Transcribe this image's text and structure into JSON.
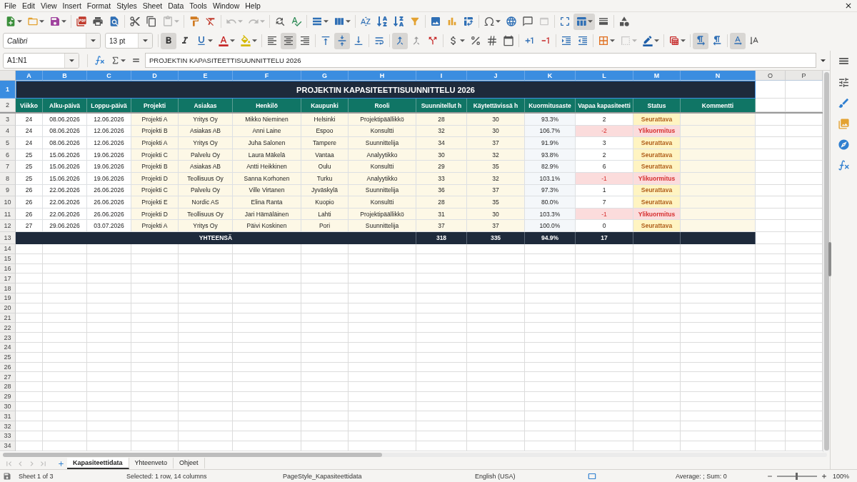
{
  "menu_bar": {
    "items": [
      "File",
      "Edit",
      "View",
      "Insert",
      "Format",
      "Styles",
      "Sheet",
      "Data",
      "Tools",
      "Window",
      "Help"
    ]
  },
  "standard_toolbar": [
    [
      {
        "kind": "new",
        "dropdown": true,
        "pressed": false,
        "disabled": false
      },
      {
        "kind": "open",
        "dropdown": true,
        "pressed": false,
        "disabled": false
      },
      {
        "kind": "save",
        "dropdown": true,
        "pressed": false,
        "disabled": false
      }
    ],
    [
      {
        "kind": "pdf",
        "dropdown": false,
        "pressed": false,
        "disabled": false
      },
      {
        "kind": "print",
        "dropdown": false,
        "pressed": false,
        "disabled": false
      },
      {
        "kind": "preview",
        "dropdown": false,
        "pressed": false,
        "disabled": false
      }
    ],
    [
      {
        "kind": "cut",
        "dropdown": false,
        "pressed": false,
        "disabled": false
      },
      {
        "kind": "copy",
        "dropdown": false,
        "pressed": false,
        "disabled": false
      },
      {
        "kind": "paste",
        "dropdown": true,
        "pressed": false,
        "disabled": true
      }
    ],
    [
      {
        "kind": "clone",
        "dropdown": false,
        "pressed": false,
        "disabled": false
      },
      {
        "kind": "clear",
        "dropdown": false,
        "pressed": false,
        "disabled": false
      }
    ],
    [
      {
        "kind": "undo",
        "dropdown": true,
        "pressed": false,
        "disabled": true
      },
      {
        "kind": "redo",
        "dropdown": true,
        "pressed": false,
        "disabled": true
      }
    ],
    [
      {
        "kind": "find",
        "dropdown": false,
        "pressed": false,
        "disabled": false
      },
      {
        "kind": "spelling",
        "dropdown": false,
        "pressed": false,
        "disabled": false
      }
    ],
    [
      {
        "kind": "rows",
        "dropdown": true,
        "pressed": false,
        "disabled": false
      },
      {
        "kind": "columns",
        "dropdown": true,
        "pressed": false,
        "disabled": false
      }
    ],
    [
      {
        "kind": "sort",
        "dropdown": false,
        "pressed": false,
        "disabled": false
      },
      {
        "kind": "sortasc",
        "dropdown": false,
        "pressed": false,
        "disabled": false
      },
      {
        "kind": "sortdesc",
        "dropdown": false,
        "pressed": false,
        "disabled": false
      },
      {
        "kind": "filter",
        "dropdown": false,
        "pressed": false,
        "disabled": false
      }
    ],
    [
      {
        "kind": "image",
        "dropdown": false,
        "pressed": false,
        "disabled": false
      },
      {
        "kind": "chart",
        "dropdown": false,
        "pressed": false,
        "disabled": false
      },
      {
        "kind": "pivot",
        "dropdown": false,
        "pressed": false,
        "disabled": false
      }
    ],
    [
      {
        "kind": "special",
        "dropdown": true,
        "pressed": false,
        "disabled": false
      },
      {
        "kind": "link",
        "dropdown": false,
        "pressed": false,
        "disabled": false
      },
      {
        "kind": "comment",
        "dropdown": false,
        "pressed": false,
        "disabled": false
      },
      {
        "kind": "header",
        "dropdown": false,
        "pressed": false,
        "disabled": true
      }
    ],
    [
      {
        "kind": "printarea",
        "dropdown": false,
        "pressed": false,
        "disabled": false
      },
      {
        "kind": "freeze",
        "dropdown": true,
        "pressed": true,
        "disabled": false
      },
      {
        "kind": "split",
        "dropdown": false,
        "pressed": false,
        "disabled": false
      }
    ],
    [
      {
        "kind": "draw",
        "dropdown": false,
        "pressed": false,
        "disabled": false
      }
    ]
  ],
  "formatting_toolbar": {
    "font_name": "Calibri",
    "font_size": "13 pt",
    "groups": [
      [
        {
          "kind": "bold",
          "dropdown": false,
          "pressed": true,
          "disabled": false
        },
        {
          "kind": "italic",
          "dropdown": false,
          "pressed": false,
          "disabled": false
        },
        {
          "kind": "underline",
          "dropdown": true,
          "pressed": false,
          "disabled": false
        },
        {
          "kind": "fontcolor",
          "dropdown": true,
          "pressed": false,
          "disabled": false
        },
        {
          "kind": "highlight",
          "dropdown": true,
          "pressed": false,
          "disabled": false
        }
      ],
      [
        {
          "kind": "alignleft",
          "dropdown": false,
          "pressed": false,
          "disabled": false
        },
        {
          "kind": "aligncenter",
          "dropdown": false,
          "pressed": true,
          "disabled": false
        },
        {
          "kind": "alignright",
          "dropdown": false,
          "pressed": false,
          "disabled": false
        }
      ],
      [
        {
          "kind": "aligntop",
          "dropdown": false,
          "pressed": false,
          "disabled": false
        },
        {
          "kind": "alignmiddle",
          "dropdown": false,
          "pressed": true,
          "disabled": false
        },
        {
          "kind": "alignbottom",
          "dropdown": false,
          "pressed": false,
          "disabled": false
        }
      ],
      [
        {
          "kind": "wrap",
          "dropdown": false,
          "pressed": false,
          "disabled": false
        }
      ],
      [
        {
          "kind": "mergecenter",
          "dropdown": false,
          "pressed": true,
          "disabled": false
        },
        {
          "kind": "merge",
          "dropdown": false,
          "pressed": false,
          "disabled": false
        },
        {
          "kind": "unmerge",
          "dropdown": false,
          "pressed": false,
          "disabled": false
        }
      ],
      [
        {
          "kind": "currency",
          "dropdown": true,
          "pressed": false,
          "disabled": false
        },
        {
          "kind": "percent",
          "dropdown": false,
          "pressed": false,
          "disabled": false
        },
        {
          "kind": "number",
          "dropdown": false,
          "pressed": false,
          "disabled": false
        },
        {
          "kind": "date",
          "dropdown": false,
          "pressed": false,
          "disabled": false
        }
      ],
      [
        {
          "kind": "adddecimal",
          "dropdown": false,
          "pressed": false,
          "disabled": false
        },
        {
          "kind": "deldecimal",
          "dropdown": false,
          "pressed": false,
          "disabled": false
        }
      ],
      [
        {
          "kind": "indent",
          "dropdown": false,
          "pressed": false,
          "disabled": false
        },
        {
          "kind": "outdent",
          "dropdown": false,
          "pressed": false,
          "disabled": false
        }
      ],
      [
        {
          "kind": "borders",
          "dropdown": true,
          "pressed": false,
          "disabled": false
        },
        {
          "kind": "borderstyle",
          "dropdown": true,
          "pressed": false,
          "disabled": true
        },
        {
          "kind": "bordercolor",
          "dropdown": true,
          "pressed": false,
          "disabled": false
        }
      ],
      [
        {
          "kind": "conditional",
          "dropdown": true,
          "pressed": false,
          "disabled": false
        }
      ],
      [
        {
          "kind": "ltr",
          "dropdown": false,
          "pressed": true,
          "disabled": false
        },
        {
          "kind": "rtl",
          "dropdown": false,
          "pressed": false,
          "disabled": false
        }
      ],
      [
        {
          "kind": "textdirection",
          "dropdown": false,
          "pressed": true,
          "disabled": false
        },
        {
          "kind": "vertical",
          "dropdown": false,
          "pressed": false,
          "disabled": false
        }
      ]
    ]
  },
  "formula_bar": {
    "name_box": "A1:N1",
    "content": "PROJEKTIN KAPASITEETTISUUNNITTELU 2026"
  },
  "sheet": {
    "columns": [
      {
        "label": "A",
        "selected": true
      },
      {
        "label": "B",
        "selected": true
      },
      {
        "label": "C",
        "selected": true
      },
      {
        "label": "D",
        "selected": true
      },
      {
        "label": "E",
        "selected": true
      },
      {
        "label": "F",
        "selected": true
      },
      {
        "label": "G",
        "selected": true
      },
      {
        "label": "H",
        "selected": true
      },
      {
        "label": "I",
        "selected": true
      },
      {
        "label": "J",
        "selected": true
      },
      {
        "label": "K",
        "selected": true
      },
      {
        "label": "L",
        "selected": true
      },
      {
        "label": "M",
        "selected": true
      },
      {
        "label": "N",
        "selected": true
      },
      {
        "label": "O",
        "selected": false
      },
      {
        "label": "P",
        "selected": false
      }
    ],
    "row_headers": [
      {
        "label": "1",
        "selected": true
      },
      {
        "label": "2",
        "selected": false
      },
      {
        "label": "3",
        "selected": false
      },
      {
        "label": "4",
        "selected": false
      },
      {
        "label": "5",
        "selected": false
      },
      {
        "label": "6",
        "selected": false
      },
      {
        "label": "7",
        "selected": false
      },
      {
        "label": "8",
        "selected": false
      },
      {
        "label": "9",
        "selected": false
      },
      {
        "label": "10",
        "selected": false
      },
      {
        "label": "11",
        "selected": false
      },
      {
        "label": "12",
        "selected": false
      },
      {
        "label": "13",
        "selected": false
      },
      {
        "label": "14",
        "selected": false
      },
      {
        "label": "15",
        "selected": false
      },
      {
        "label": "16",
        "selected": false
      },
      {
        "label": "17",
        "selected": false
      },
      {
        "label": "18",
        "selected": false
      },
      {
        "label": "19",
        "selected": false
      },
      {
        "label": "20",
        "selected": false
      },
      {
        "label": "21",
        "selected": false
      },
      {
        "label": "22",
        "selected": false
      },
      {
        "label": "23",
        "selected": false
      },
      {
        "label": "24",
        "selected": false
      },
      {
        "label": "25",
        "selected": false
      },
      {
        "label": "26",
        "selected": false
      },
      {
        "label": "27",
        "selected": false
      },
      {
        "label": "28",
        "selected": false
      },
      {
        "label": "29",
        "selected": false
      },
      {
        "label": "30",
        "selected": false
      },
      {
        "label": "31",
        "selected": false
      },
      {
        "label": "32",
        "selected": false
      },
      {
        "label": "33",
        "selected": false
      },
      {
        "label": "34",
        "selected": false
      }
    ],
    "title": "PROJEKTIN KAPASITEETTISUUNNITTELU 2026",
    "headers": [
      "Viikko",
      "Alku-päivä",
      "Loppu-päivä",
      "Projekti",
      "Asiakas",
      "Henkilö",
      "Kaupunki",
      "Rooli",
      "Suunnitellut h",
      "Käytettävissä h",
      "Kuormitusaste",
      "Vapaa kapasiteetti",
      "Status",
      "Kommentti"
    ],
    "rows": [
      {
        "cells": [
          "24",
          "08.06.2026",
          "12.06.2026",
          "Projekti A",
          "Yritys Oy",
          "Mikko Nieminen",
          "Helsinki",
          "Projektipäällikkö",
          "28",
          "30",
          "93.3%",
          "2",
          "Seurattava"
        ],
        "overloaded": false
      },
      {
        "cells": [
          "24",
          "08.06.2026",
          "12.06.2026",
          "Projekti B",
          "Asiakas AB",
          "Anni Laine",
          "Espoo",
          "Konsultti",
          "32",
          "30",
          "106.7%",
          "-2",
          "Ylikuormitus"
        ],
        "overloaded": true
      },
      {
        "cells": [
          "24",
          "08.06.2026",
          "12.06.2026",
          "Projekti A",
          "Yritys Oy",
          "Juha Salonen",
          "Tampere",
          "Suunnittelija",
          "34",
          "37",
          "91.9%",
          "3",
          "Seurattava"
        ],
        "overloaded": false
      },
      {
        "cells": [
          "25",
          "15.06.2026",
          "19.06.2026",
          "Projekti C",
          "Palvelu Oy",
          "Laura Mäkelä",
          "Vantaa",
          "Analyytikko",
          "30",
          "32",
          "93.8%",
          "2",
          "Seurattava"
        ],
        "overloaded": false
      },
      {
        "cells": [
          "25",
          "15.06.2026",
          "19.06.2026",
          "Projekti B",
          "Asiakas AB",
          "Antti Heikkinen",
          "Oulu",
          "Konsultti",
          "29",
          "35",
          "82.9%",
          "6",
          "Seurattava"
        ],
        "overloaded": false
      },
      {
        "cells": [
          "25",
          "15.06.2026",
          "19.06.2026",
          "Projekti D",
          "Teollisuus Oy",
          "Sanna Korhonen",
          "Turku",
          "Analyytikko",
          "33",
          "32",
          "103.1%",
          "-1",
          "Ylikuormitus"
        ],
        "overloaded": true
      },
      {
        "cells": [
          "26",
          "22.06.2026",
          "26.06.2026",
          "Projekti C",
          "Palvelu Oy",
          "Ville Virtanen",
          "Jyväskylä",
          "Suunnittelija",
          "36",
          "37",
          "97.3%",
          "1",
          "Seurattava"
        ],
        "overloaded": false
      },
      {
        "cells": [
          "26",
          "22.06.2026",
          "26.06.2026",
          "Projekti E",
          "Nordic AS",
          "Elina Ranta",
          "Kuopio",
          "Konsultti",
          "28",
          "35",
          "80.0%",
          "7",
          "Seurattava"
        ],
        "overloaded": false
      },
      {
        "cells": [
          "26",
          "22.06.2026",
          "26.06.2026",
          "Projekti D",
          "Teollisuus Oy",
          "Jari Hämäläinen",
          "Lahti",
          "Projektipäällikkö",
          "31",
          "30",
          "103.3%",
          "-1",
          "Ylikuormitus"
        ],
        "overloaded": true
      },
      {
        "cells": [
          "27",
          "29.06.2026",
          "03.07.2026",
          "Projekti A",
          "Yritys Oy",
          "Päivi Koskinen",
          "Pori",
          "Suunnittelija",
          "37",
          "37",
          "100.0%",
          "0",
          "Seurattava"
        ],
        "overloaded": false
      }
    ],
    "totals": {
      "label": "YHTEENSÄ",
      "values": [
        "318",
        "335",
        "94.9%",
        "17"
      ]
    }
  },
  "sheet_tabs": {
    "navigation_disabled": true,
    "tabs": [
      {
        "label": "Kapasiteettidata",
        "selected": true
      },
      {
        "label": "Yhteenveto",
        "selected": false
      },
      {
        "label": "Ohjeet",
        "selected": false
      }
    ]
  },
  "status_bar": {
    "sheet": "Sheet 1 of 3",
    "selection": "Selected: 1 row, 14 columns",
    "page_style": "PageStyle_Kapasiteettidata",
    "language": "English (USA)",
    "summary": "Average: ; Sum: 0",
    "zoom": {
      "level": 0.5,
      "label": "100%"
    }
  }
}
